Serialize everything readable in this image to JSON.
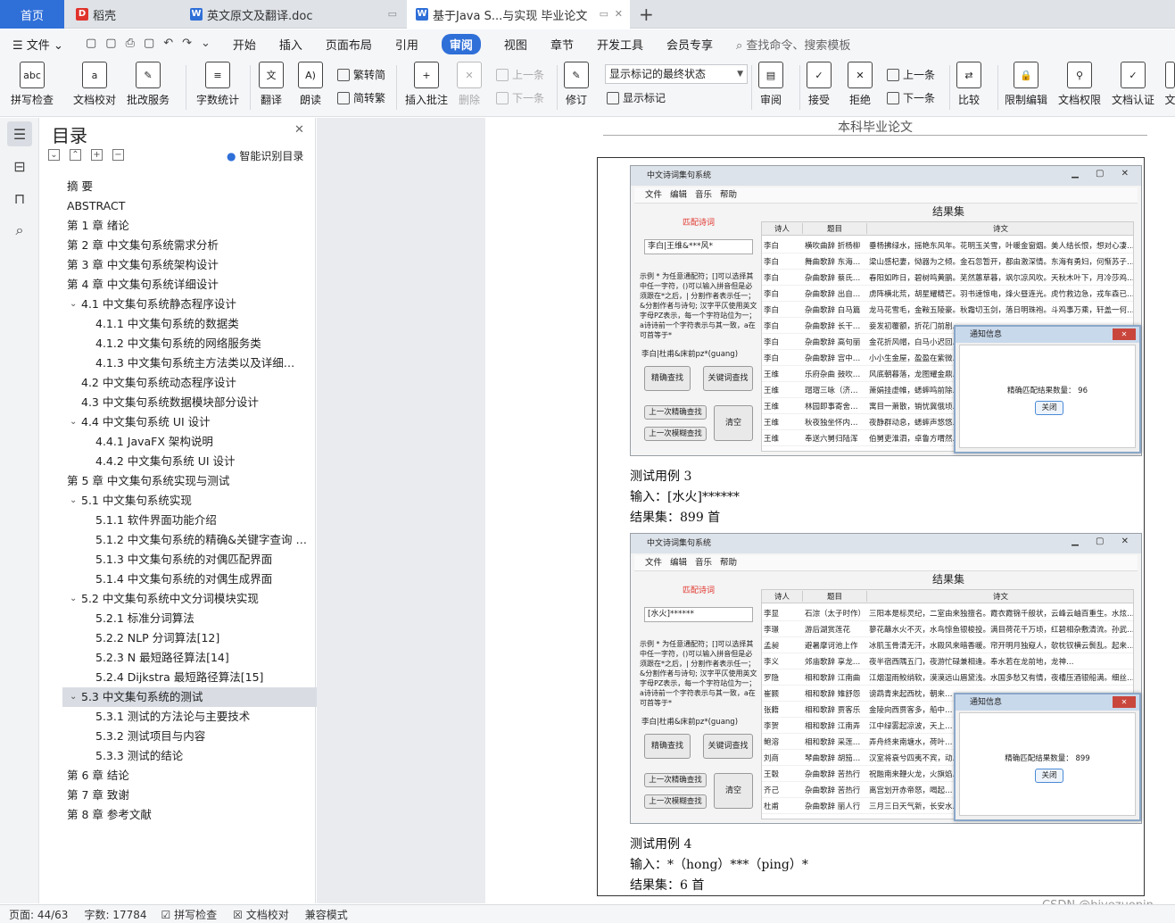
{
  "tabs": [
    {
      "label": "首页"
    },
    {
      "label": "稻壳"
    },
    {
      "label": "英文原文及翻译.doc"
    },
    {
      "label": "基于Java S...与实现 毕业论文"
    }
  ],
  "menubar": {
    "file": "文件",
    "items": [
      "开始",
      "插入",
      "页面布局",
      "引用",
      "审阅",
      "视图",
      "章节",
      "开发工具",
      "会员专享"
    ],
    "search": "查找命令、搜索模板"
  },
  "ribbon": {
    "spell": "拼写检查",
    "proof": "文档校对",
    "annot_service": "批改服务",
    "wordcount": "字数统计",
    "translate": "翻译",
    "read": "朗读",
    "trad": "繁转简",
    "simp": "简转繁",
    "insert_comment": "插入批注",
    "delete": "删除",
    "prev": "上一条",
    "next": "下一条",
    "revise": "修订",
    "markup_state": "显示标记的最终状态",
    "show_markup": "显示标记",
    "review": "审阅",
    "accept": "接受",
    "reject": "拒绝",
    "prev2": "上一条",
    "next2": "下一条",
    "compare": "比较",
    "restrict": "限制编辑",
    "doc_perm": "文档权限",
    "doc_cert": "文档认证",
    "cut": "文"
  },
  "toc": {
    "title": "目录",
    "smart": "智能识别目录",
    "items": [
      {
        "text": "摘    要"
      },
      {
        "text": "ABSTRACT"
      },
      {
        "text": "第 1 章  绪论"
      },
      {
        "text": "第 2 章  中文集句系统需求分析"
      },
      {
        "text": "第 3 章  中文集句系统架构设计"
      },
      {
        "text": "第 4 章  中文集句系统详细设计"
      },
      {
        "text": "4.1    中文集句系统静态程序设计"
      },
      {
        "text": "4.1.1    中文集句系统的数据类"
      },
      {
        "text": "4.1.2    中文集句系统的网络服务类"
      },
      {
        "text": "4.1.3    中文集句系统主方法类以及详细…"
      },
      {
        "text": "4.2    中文集句系统动态程序设计"
      },
      {
        "text": "4.3  中文集句系统数据模块部分设计"
      },
      {
        "text": "4.4  中文集句系统 UI 设计"
      },
      {
        "text": "4.4.1  JavaFX 架构说明"
      },
      {
        "text": "4.4.2  中文集句系统 UI 设计"
      },
      {
        "text": "第 5 章  中文集句系统实现与测试"
      },
      {
        "text": "5.1  中文集句系统实现"
      },
      {
        "text": "5.1.1  软件界面功能介绍"
      },
      {
        "text": "5.1.2  中文集句系统的精确&关键字查询 …"
      },
      {
        "text": "5.1.3  中文集句系统的对偶匹配界面"
      },
      {
        "text": "5.1.4  中文集句系统的对偶生成界面"
      },
      {
        "text": "5.2  中文集句系统中文分词模块实现"
      },
      {
        "text": "5.2.1  标准分词算法"
      },
      {
        "text": "5.2.2  NLP 分词算法[12]"
      },
      {
        "text": "5.2.3  N 最短路径算法[14]"
      },
      {
        "text": "5.2.4  Dijkstra 最短路径算法[15]"
      },
      {
        "text": "5.3  中文集句系统的测试"
      },
      {
        "text": "5.3.1  测试的方法论与主要技术"
      },
      {
        "text": "5.3.2  测试项目与内容"
      },
      {
        "text": "5.3.3  测试的结论"
      },
      {
        "text": "第 6 章  结论"
      },
      {
        "text": "第 7 章  致谢"
      },
      {
        "text": "第 8 章  参考文献"
      }
    ]
  },
  "document": {
    "header": "本科毕业论文",
    "case3_title": "测试用例 3",
    "case3_input": "输入：[水火]******",
    "case3_result": "结果集：899 首",
    "case4_title": "测试用例 4",
    "case4_input": "输入：*（hong）***（ping）*",
    "case4_result": "结果集：6 首"
  },
  "app_shot_1": {
    "title": "中文诗词集句系统",
    "menu": "文件   编辑   音乐   帮助",
    "mode": "匹配诗词",
    "query": "李白|王维&***风*",
    "help": "示例 * 为任意通配符；[]可以选择其中任一字符，()可以输入拼音但是必须跟在*之后，| 分割作者表示任一；&分割作者与诗句; 汉字平仄使用英文字母PZ表示，每一个字符站位为一；a诗诗前一个字符表示与其一致，a在可首等于*",
    "hint": "李白|杜甫&床前pz*(guang)",
    "btn_exact": "精确查找",
    "btn_key": "关键词查找",
    "btn_prev_exact": "上一次精确查找",
    "btn_prev_fuzzy": "上一次模糊查找",
    "btn_clear": "清空",
    "result_title": "结果集",
    "cols": [
      "诗人",
      "题目",
      "诗文"
    ],
    "rows": [
      [
        "李白",
        "横吹曲辞 折杨柳",
        "垂杨拂绿水，摇艳东风年。花明玉关雪，叶暖金窗烟。美人结长恨，想对心凄…"
      ],
      [
        "李白",
        "舞曲歌辞 东海…",
        "梁山感杞妻，恸器为之倾。金石忽暂开，都由激深情。东海有勇妇，何惭苏子…"
      ],
      [
        "李白",
        "杂曲歌辞 蔡氏…",
        "春阳如昨日，碧树鸣黄鹂。芜然蕙草暮，飒尔凉风吹。天秋木叶下，月冷莎鸡…"
      ],
      [
        "李白",
        "杂曲歌辞 出自…",
        "虏阵横北荒，胡星耀精芒。羽书速惊电，烽火昼连光。虎竹救边急，戎车森已…"
      ],
      [
        "李白",
        "杂曲歌辞 白马篇",
        "龙马花雪毛，金鞍五陵豪。秋霜切玉剑，落日明珠袍。斗鸡事万乘，轩盖一何…"
      ],
      [
        "李白",
        "杂曲歌辞 长干…",
        "妾发初覆额，折花门前剧…"
      ],
      [
        "李白",
        "杂曲歌辞 高句丽",
        "金花折风帽，白马小迟回…"
      ],
      [
        "李白",
        "杂曲歌辞 宫中…",
        "小小生金屋，盈盈在紫微…"
      ],
      [
        "王维",
        "乐府杂曲 鼓吹…",
        "风底朝暮落，龙图耀金鼎…"
      ],
      [
        "王维",
        "瑁瑁三咏（济…",
        "萧娟挂虚帷，蟋蟀鸣前除…"
      ],
      [
        "王维",
        "林园即事寄舍…",
        "寓目一萧散，销忧冀俄顷…"
      ],
      [
        "王维",
        "秋夜独坐怀内…",
        "夜静群动息，蟋蟀声悠悠…"
      ],
      [
        "王维",
        "奉送六舅归陆浑",
        "伯舅吏淮泗，卓鲁方喟然…"
      ]
    ],
    "dialog_title": "通知信息",
    "dialog_msg": "精确匹配结果数量：  96",
    "dialog_btn": "关闭"
  },
  "app_shot_2": {
    "title": "中文诗词集句系统",
    "menu": "文件   编辑   音乐   帮助",
    "mode": "匹配诗词",
    "query": "[水火]******",
    "help": "示例 * 为任意通配符；[]可以选择其中任一字符，()可以输入拼音但是必须跟在*之后，| 分割作者表示任一；&分割作者与诗句; 汉字平仄使用英文字母PZ表示，每一个字符站位为一；a诗诗前一个字符表示与其一致，a在可首等于*",
    "hint": "李白|杜甫&床前pz*(guang)",
    "btn_exact": "精确查找",
    "btn_key": "关键词查找",
    "btn_prev_exact": "上一次精确查找",
    "btn_prev_fuzzy": "上一次模糊查找",
    "btn_clear": "清空",
    "result_title": "结果集",
    "cols": [
      "诗人",
      "题目",
      "诗文"
    ],
    "rows": [
      [
        "李显",
        "石淙（太子时作）",
        "三阳本是标灵纪，二室由来独擅名。霞衣霞锦千般状，云峰云岫百重生。水炫…"
      ],
      [
        "李璟",
        "游后湖赏莲花",
        "蓼花蘸水火不灭，水鸟惊鱼银梭投。满目荷花千万顷，红碧相杂敷清流。孙武…"
      ],
      [
        "孟昶",
        "避暑摩诃池上作",
        "冰肌玉骨清无汗，水殿风来暗香暖。帘开明月独窥人，欹枕钗横云鬓乱。起来…"
      ],
      [
        "李义",
        "郊庙歌辞 享龙…",
        "夜半宿西隅五门，夜游忙碌兼相逢。奉水若在龙前地，龙神…"
      ],
      [
        "罗隐",
        "相和歌辞 江南曲",
        "江烟湿雨鲛绡软，漠漠远山眉黛浅。水国多愁又有情，夜槽压酒银船满。细丝…"
      ],
      [
        "崔颢",
        "相和歌辞 雉舒怨",
        "谤鹉青来起西枕，朝来…"
      ],
      [
        "张籍",
        "相和歌辞 贾客乐",
        "金陵向西贾客多，船中…"
      ],
      [
        "李贺",
        "相和歌辞 江南弄",
        "江中绿雾起凉波，天上…"
      ],
      [
        "鲍溶",
        "相和歌辞 采莲…",
        "弄舟终来南塘水，荷叶…"
      ],
      [
        "刘商",
        "琴曲歌辞 胡笳…",
        "汉室将衰兮四夷不宾，动…"
      ],
      [
        "王毂",
        "杂曲歌辞 苦热行",
        "祝融南来鞭火龙，火旗焰…"
      ],
      [
        "齐己",
        "杂曲歌辞 苦热行",
        "离宫划开赤帝怒，喝起…"
      ],
      [
        "杜甫",
        "杂曲歌辞 丽人行",
        "三月三日天气新，长安水…"
      ]
    ],
    "dialog_title": "通知信息",
    "dialog_msg": "精确匹配结果数量：  899",
    "dialog_btn": "关闭"
  },
  "status": {
    "page": "页面: 44/63",
    "words": "字数: 17784",
    "spell": "拼写检查",
    "proof": "文档校对",
    "compat": "兼容模式",
    "watermark": "CSDN @biyezuopin"
  },
  "colors": {
    "accent": "#2f6fd8",
    "mode_red": "#e0332b"
  }
}
